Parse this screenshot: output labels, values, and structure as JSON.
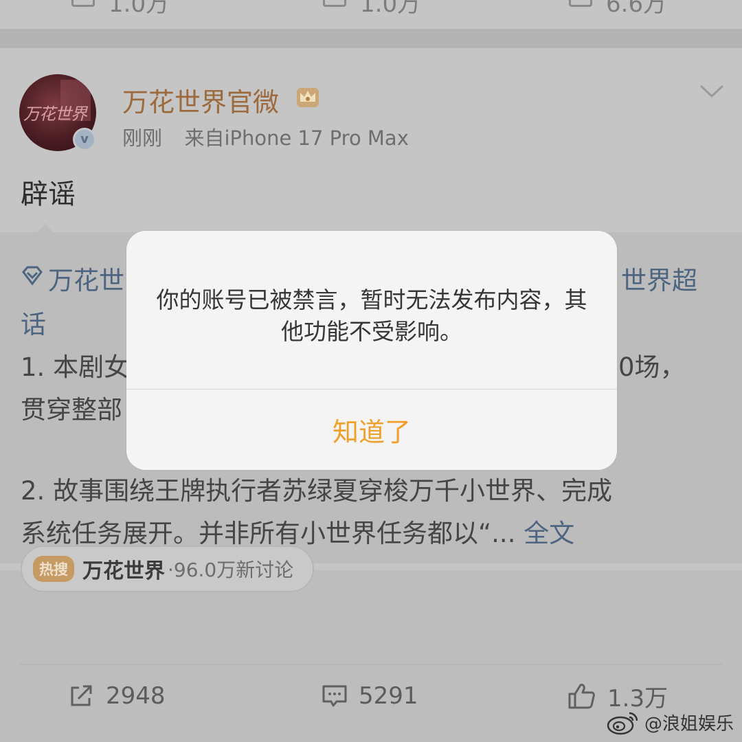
{
  "top_stub": {
    "counts": [
      "1.0万",
      "1.0万",
      "6.6万"
    ]
  },
  "post": {
    "author": "万花世界官微",
    "avatar_text": "万花世界",
    "time": "刚刚",
    "source": "来自iPhone 17 Pro Max",
    "text": "辟谣",
    "icons": {
      "crown": "crown-icon",
      "verified": "verified-badge-icon",
      "more": "chevron-down-icon"
    }
  },
  "repost": {
    "line1_left": "万花世",
    "line1_right": "世界超",
    "line2": "话",
    "line3_left": "1. 本剧女",
    "line3_right": "0场，",
    "line4_left": "贯穿整部",
    "line5": "2. 故事围绕王牌执行者苏绿夏穿梭万千小世界、完成",
    "line6": "系统任务展开。并非所有小世界任务都以“...",
    "full_text_link": "全文"
  },
  "hot_search": {
    "badge": "热搜",
    "topic": "万花世界",
    "discussion": "·96.0万新讨论"
  },
  "actions": {
    "repost_count": "2948",
    "comment_count": "5291",
    "like_count": "1.3万"
  },
  "watermark": {
    "text": "@浪姐娱乐"
  },
  "dialog": {
    "message": "你的账号已被禁言，暂时无法发布内容，其他功能不受影响。",
    "button_label": "知道了"
  },
  "colors": {
    "dialog_button": "#f0a02a",
    "author_name": "#9c6a3c",
    "link": "#4d6580"
  }
}
